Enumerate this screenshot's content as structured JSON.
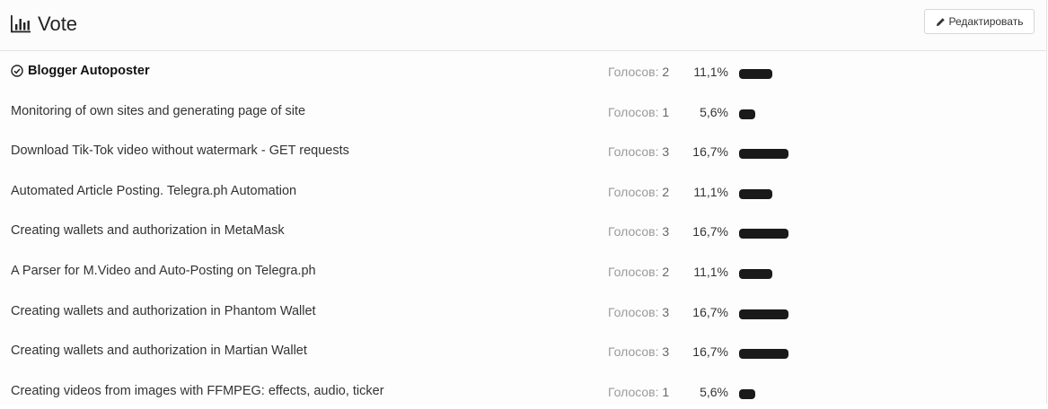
{
  "header": {
    "title": "Vote",
    "edit_label": "Редактировать"
  },
  "votes_label": "Голосов:",
  "colors": {
    "bar": "#1a1a1a",
    "muted_text": "#9a9a9a"
  },
  "options": [
    {
      "label": "Blogger Autoposter",
      "votes": "2",
      "percent": "11,1%",
      "fraction": 0.111,
      "selected": true
    },
    {
      "label": "Monitoring of own sites and generating page of site",
      "votes": "1",
      "percent": "5,6%",
      "fraction": 0.056,
      "selected": false
    },
    {
      "label": "Download Tik-Tok video without watermark - GET requests",
      "votes": "3",
      "percent": "16,7%",
      "fraction": 0.167,
      "selected": false
    },
    {
      "label": "Automated Article Posting. Telegra.ph Automation",
      "votes": "2",
      "percent": "11,1%",
      "fraction": 0.111,
      "selected": false
    },
    {
      "label": "Creating wallets and authorization in MetaMask",
      "votes": "3",
      "percent": "16,7%",
      "fraction": 0.167,
      "selected": false
    },
    {
      "label": "A Parser for M.Video and Auto-Posting on Telegra.ph",
      "votes": "2",
      "percent": "11,1%",
      "fraction": 0.111,
      "selected": false
    },
    {
      "label": "Creating wallets and authorization in Phantom Wallet",
      "votes": "3",
      "percent": "16,7%",
      "fraction": 0.167,
      "selected": false
    },
    {
      "label": "Creating wallets and authorization in Martian Wallet",
      "votes": "3",
      "percent": "16,7%",
      "fraction": 0.167,
      "selected": false
    },
    {
      "label": "Creating videos from images with FFMPEG: effects, audio, ticker",
      "votes": "1",
      "percent": "5,6%",
      "fraction": 0.056,
      "selected": false
    }
  ]
}
